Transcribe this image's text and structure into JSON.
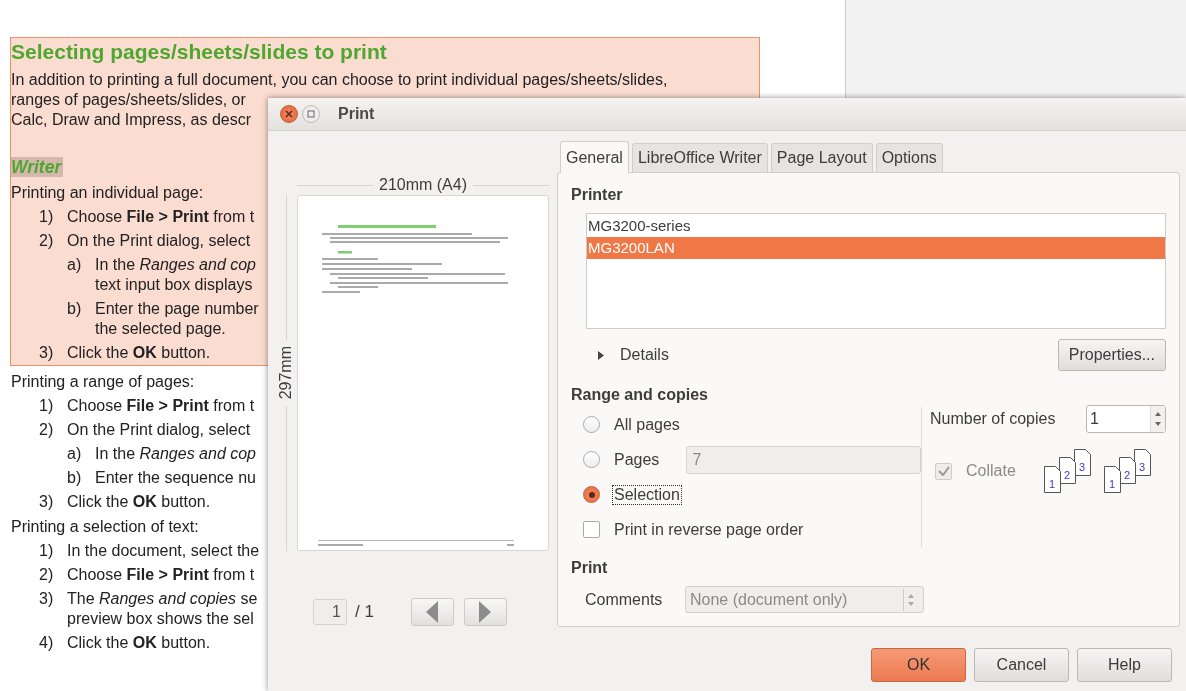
{
  "document": {
    "selected_block": {
      "heading": "Selecting pages/sheets/slides to print",
      "intro": [
        "In addition to printing a full document, you can choose to print individual pages/sheets/slides,",
        "ranges of pages/sheets/slides, or",
        "Calc, Draw and Impress, as descr"
      ],
      "subheading": "Writer",
      "sections": [
        {
          "lead": "Printing an individual page:",
          "steps": [
            {
              "marker": "1)",
              "lines": [
                "Choose **File > Print** from t"
              ]
            },
            {
              "marker": "2)",
              "lines": [
                "On the Print dialog, select"
              ],
              "children": [
                {
                  "marker": "a)",
                  "lines": [
                    "In the *Ranges and cop*",
                    "text input box displays"
                  ]
                },
                {
                  "marker": "b)",
                  "lines": [
                    "Enter the page number",
                    "the selected page."
                  ]
                }
              ]
            },
            {
              "marker": "3)",
              "lines": [
                "Click the **OK** button."
              ]
            }
          ]
        }
      ]
    },
    "sections": [
      {
        "lead": "Printing a range of pages:",
        "steps": [
          {
            "marker": "1)",
            "lines": [
              "Choose **File > Print** from t"
            ]
          },
          {
            "marker": "2)",
            "lines": [
              "On the Print dialog, select"
            ],
            "children": [
              {
                "marker": "a)",
                "lines": [
                  "In the *Ranges and cop*"
                ]
              },
              {
                "marker": "b)",
                "lines": [
                  "Enter the sequence nu"
                ]
              }
            ]
          },
          {
            "marker": "3)",
            "lines": [
              "Click the **OK** button."
            ]
          }
        ]
      },
      {
        "lead": "Printing a selection of text:",
        "steps": [
          {
            "marker": "1)",
            "lines": [
              "In the document, select the"
            ]
          },
          {
            "marker": "2)",
            "lines": [
              "Choose **File > Print** from t"
            ]
          },
          {
            "marker": "3)",
            "lines": [
              "The *Ranges and copies* se",
              "preview box shows the sel"
            ]
          },
          {
            "marker": "4)",
            "lines": [
              "Click the **OK** button."
            ]
          }
        ]
      }
    ]
  },
  "print_dialog": {
    "title": "Print",
    "preview": {
      "width_label": "210mm (A4)",
      "height_label": "297mm",
      "page_field": "1",
      "page_total": "/ 1"
    },
    "tabs": [
      {
        "label": "General",
        "selected": true
      },
      {
        "label": "LibreOffice Writer",
        "selected": false
      },
      {
        "label": "Page Layout",
        "selected": false
      },
      {
        "label": "Options",
        "selected": false
      }
    ],
    "printer": {
      "heading": "Printer",
      "printers": [
        {
          "name": "MG3200-series",
          "selected": false
        },
        {
          "name": "MG3200LAN",
          "selected": true
        }
      ],
      "details": "Details",
      "properties": "Properties..."
    },
    "range": {
      "heading": "Range and copies",
      "options": [
        {
          "label": "All pages",
          "selected": false,
          "focused": false
        },
        {
          "label": "Pages",
          "selected": false,
          "focused": false,
          "field": "7"
        },
        {
          "label": "Selection",
          "selected": true,
          "focused": true
        }
      ],
      "reverse": {
        "label": "Print in reverse page order",
        "checked": false
      },
      "copies": {
        "label": "Number of copies",
        "value": "1"
      },
      "collate": {
        "label": "Collate",
        "checked": true,
        "disabled": true,
        "icons": [
          {
            "numbers": [
              "1",
              "2",
              "3"
            ]
          },
          {
            "numbers": [
              "1",
              "2",
              "3"
            ]
          }
        ]
      }
    },
    "print": {
      "heading": "Print",
      "comments_label": "Comments",
      "comments_value": "None (document only)",
      "comments_disabled": true
    },
    "buttons": [
      {
        "label": "OK",
        "kind": "default"
      },
      {
        "label": "Cancel",
        "kind": "normal"
      },
      {
        "label": "Help",
        "kind": "normal"
      }
    ]
  }
}
